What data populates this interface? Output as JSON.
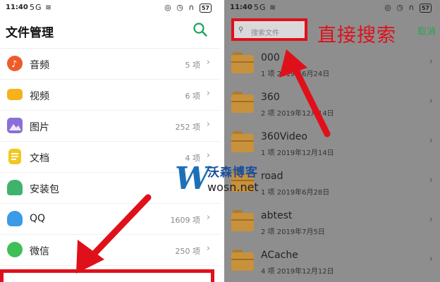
{
  "left": {
    "status": {
      "time": "11:40",
      "net": "5G ≋",
      "sys": "◎ ◷ ∩",
      "battery": "57"
    },
    "title": "文件管理",
    "categories": [
      {
        "name": "音频",
        "count": "5 项",
        "icon_color": "#ee5b2a"
      },
      {
        "name": "视频",
        "count": "6 项",
        "icon_color": "#f6b21a"
      },
      {
        "name": "图片",
        "count": "252 项",
        "icon_color": "#8a6fd6"
      },
      {
        "name": "文档",
        "count": "4 项",
        "icon_color": "#f2c81f"
      },
      {
        "name": "安装包",
        "count": "",
        "icon_color": "#3fb36b"
      },
      {
        "name": "QQ",
        "count": "1609 项",
        "icon_color": "#3a9be6"
      },
      {
        "name": "微信",
        "count": "250 项",
        "icon_color": "#3fbf58"
      }
    ]
  },
  "right": {
    "status": {
      "time": "11:40",
      "net": "5G ≋",
      "sys": "◎ ◷ ∩",
      "battery": "57"
    },
    "search_placeholder": "搜索文件",
    "callout": "直接搜索",
    "cancel": "取消",
    "folders": [
      {
        "name": "000",
        "meta": "1 项 2019年6月24日"
      },
      {
        "name": "360",
        "meta": "2 项 2019年12月14日"
      },
      {
        "name": "360Video",
        "meta": "1 项 2019年12月14日"
      },
      {
        "name": "road",
        "meta": "1 项 2019年6月28日"
      },
      {
        "name": "abtest",
        "meta": "2 项 2019年7月5日"
      },
      {
        "name": "ACache",
        "meta": "4 项 2019年12月12日"
      }
    ]
  },
  "watermark": {
    "logo": "W",
    "cn": "沃森博客",
    "url": "wosn.net"
  },
  "colors": {
    "accent_red": "#e0101a",
    "cancel_green": "#2fa24b",
    "search_green": "#1aa35a"
  }
}
